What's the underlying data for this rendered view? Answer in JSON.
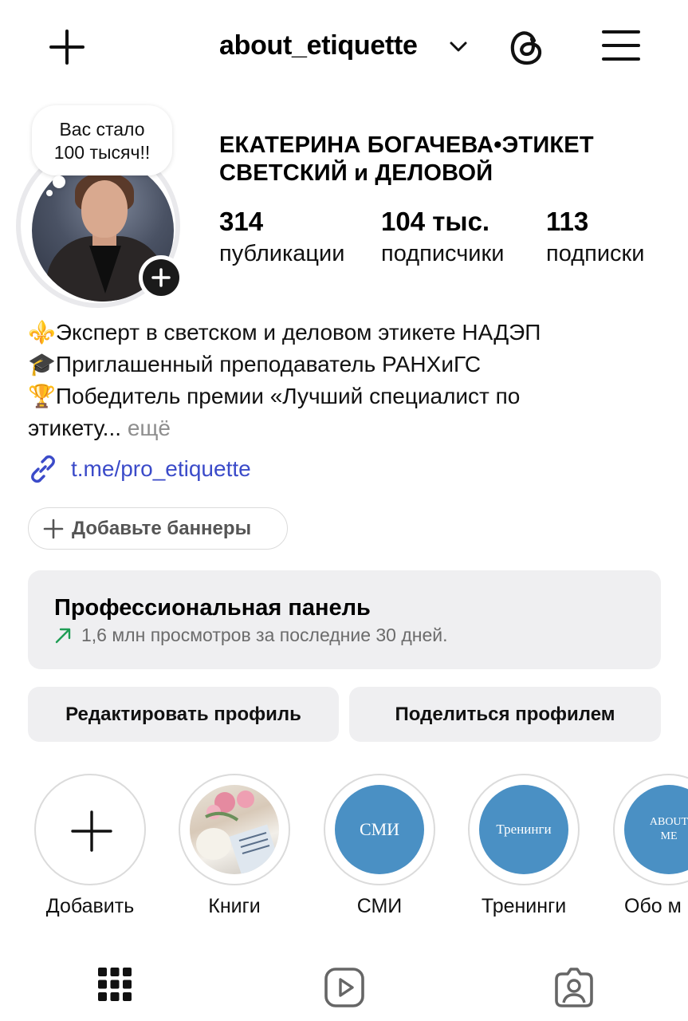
{
  "header": {
    "username": "about_etiquette"
  },
  "profile": {
    "note": [
      "Вас стало",
      "100 тысяч!!"
    ],
    "name_line1": "ЕКАТЕРИНА БОГАЧЕВА•ЭТИКЕТ",
    "name_line2": "СВЕТСКИЙ и ДЕЛОВОЙ",
    "stats": [
      {
        "value": "314",
        "label": "публикации"
      },
      {
        "value": "104 тыс.",
        "label": "подписчики"
      },
      {
        "value": "113",
        "label": "подписки"
      }
    ],
    "bio": {
      "line1_emoji": "⚜️",
      "line1": "Эксперт в светском и деловом этикете НАДЭП",
      "line2_emoji": "🎓",
      "line2": "Приглашенный преподаватель РАНХиГС",
      "line3_emoji": "🏆",
      "line3": "Победитель премии «Лучший специалист по",
      "line4": "этикету...",
      "more": "ещё"
    },
    "link": "t.me/pro_etiquette",
    "add_banners": "Добавьте баннеры"
  },
  "pro_panel": {
    "title": "Профессиональная панель",
    "subtitle": "1,6 млн просмотров за последние 30 дней."
  },
  "buttons": {
    "edit": "Редактировать профиль",
    "share": "Поделиться профилем"
  },
  "highlights": [
    {
      "label": "Добавить",
      "cover": ""
    },
    {
      "label": "Книги",
      "cover": ""
    },
    {
      "label": "СМИ",
      "cover": "СМИ"
    },
    {
      "label": "Тренинги",
      "cover": "Тренинги"
    },
    {
      "label": "Обо м",
      "cover": "ABOUT ME"
    }
  ],
  "colors": {
    "link": "#3b4bc9",
    "panel_bg": "#efeff1",
    "highlight_blue": "#4a90c4",
    "trend_green": "#1f9d55"
  },
  "icons": {
    "top": [
      "plus-icon",
      "chevron-down-icon",
      "threads-icon",
      "menu-icon"
    ],
    "tabs": [
      "grid-icon",
      "reels-icon",
      "tagged-icon"
    ]
  }
}
